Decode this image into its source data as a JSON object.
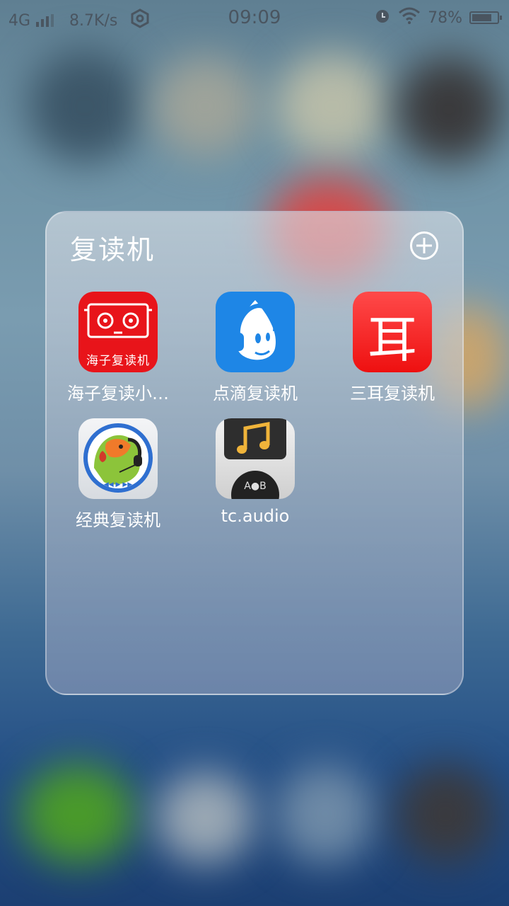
{
  "status_bar": {
    "network": "4G",
    "speed": "8.7K/s",
    "time": "09:09",
    "battery_percent": "78%",
    "battery_level": 0.78,
    "icons": [
      "signal-icon",
      "vpn-hex-icon",
      "alarm-icon",
      "wifi-icon",
      "battery-icon"
    ]
  },
  "folder": {
    "title": "复读机",
    "add_icon": "plus-circle-icon",
    "apps": [
      {
        "label": "海子复读小…",
        "icon": "haizi-icon",
        "icon_text": "海子复读机",
        "color": "#e8141a"
      },
      {
        "label": "点滴复读机",
        "icon": "diandi-icon",
        "color": "#1e86e6"
      },
      {
        "label": "三耳复读机",
        "icon": "saner-icon",
        "icon_glyph": "耳",
        "color": "#ff2a2a"
      },
      {
        "label": "经典复读机",
        "icon": "parrot-icon",
        "color": "#dfe3e8"
      },
      {
        "label": "tc.audio",
        "icon": "tc-audio-icon",
        "icon_text": "A●B",
        "color": "#2b2b2b"
      }
    ]
  }
}
